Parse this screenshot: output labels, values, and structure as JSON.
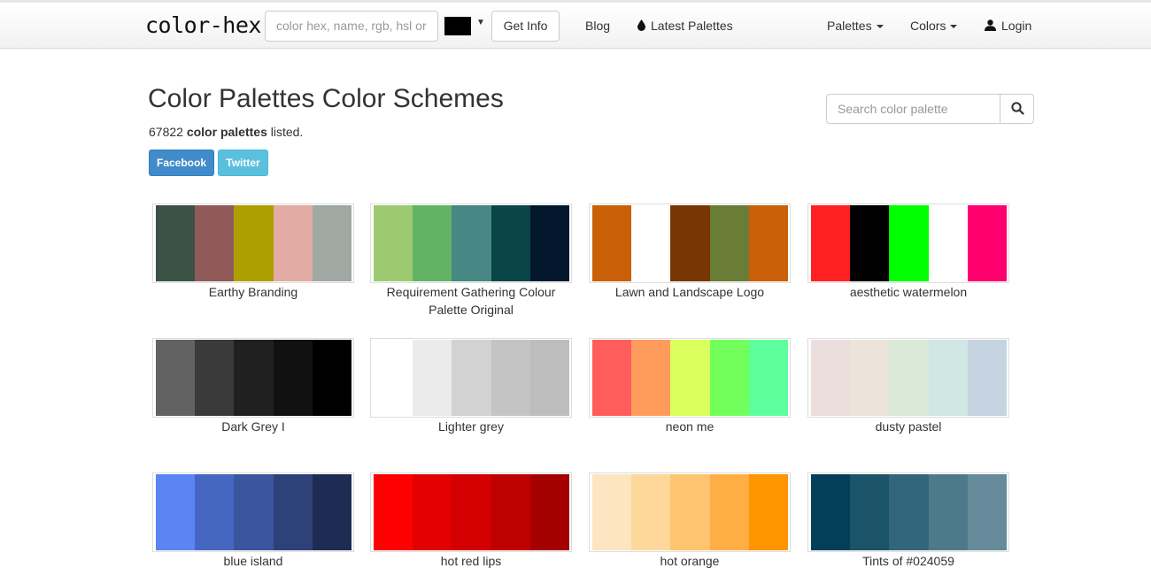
{
  "navbar": {
    "brand": "color-hex",
    "search_placeholder": "color hex, name, rgb, hsl or",
    "swatch_color": "#000000",
    "get_info_label": "Get Info",
    "links": {
      "blog": "Blog",
      "latest": "Latest Palettes",
      "palettes": "Palettes",
      "colors": "Colors",
      "login": "Login"
    }
  },
  "header": {
    "title": "Color Palettes Color Schemes",
    "count": "67822",
    "count_bold": "color palettes",
    "count_suffix": "listed.",
    "facebook_label": "Facebook",
    "twitter_label": "Twitter",
    "search_placeholder": "Search color palette"
  },
  "palettes": [
    {
      "name": "Earthy Branding",
      "colors": [
        "#3d5247",
        "#905a59",
        "#ad9f00",
        "#e2aba3",
        "#9fa8a3"
      ]
    },
    {
      "name": "Requirement Gathering Colour Palette Original",
      "colors": [
        "#9dca71",
        "#62b464",
        "#478784",
        "#0a4647",
        "#03182c"
      ]
    },
    {
      "name": "Lawn and Landscape Logo",
      "colors": [
        "#c96008",
        "#ffffff",
        "#773603",
        "#6a7d37",
        "#c96008"
      ]
    },
    {
      "name": "aesthetic watermelon",
      "colors": [
        "#ff2121",
        "#000000",
        "#00ff00",
        "#ffffff",
        "#ff006e"
      ]
    },
    {
      "name": "Dark Grey I",
      "colors": [
        "#626262",
        "#3a3a3a",
        "#202020",
        "#111111",
        "#000000"
      ]
    },
    {
      "name": "Lighter grey",
      "colors": [
        "#ffffff",
        "#ebebeb",
        "#d2d2d2",
        "#c4c4c4",
        "#bdbdbd"
      ]
    },
    {
      "name": "neon me",
      "colors": [
        "#ff5c5c",
        "#ff9c5c",
        "#dbff5c",
        "#72ff5c",
        "#5cff9c"
      ]
    },
    {
      "name": "dusty pastel",
      "colors": [
        "#ecdddd",
        "#ece4d9",
        "#d9ead6",
        "#d0e7e3",
        "#c5d4e0"
      ]
    },
    {
      "name": "blue island",
      "colors": [
        "#5a85f2",
        "#4667c1",
        "#3b559e",
        "#2e4279",
        "#1e2b53"
      ]
    },
    {
      "name": "hot red lips",
      "colors": [
        "#ff0000",
        "#e30000",
        "#d20000",
        "#bf0000",
        "#a40000"
      ]
    },
    {
      "name": "hot orange",
      "colors": [
        "#fee5c1",
        "#fed79a",
        "#fec46f",
        "#feae45",
        "#fe9501"
      ]
    },
    {
      "name": "Tints of #024059",
      "colors": [
        "#024059",
        "#1b5368",
        "#34667b",
        "#4d7a8b",
        "#668b9b"
      ]
    }
  ]
}
